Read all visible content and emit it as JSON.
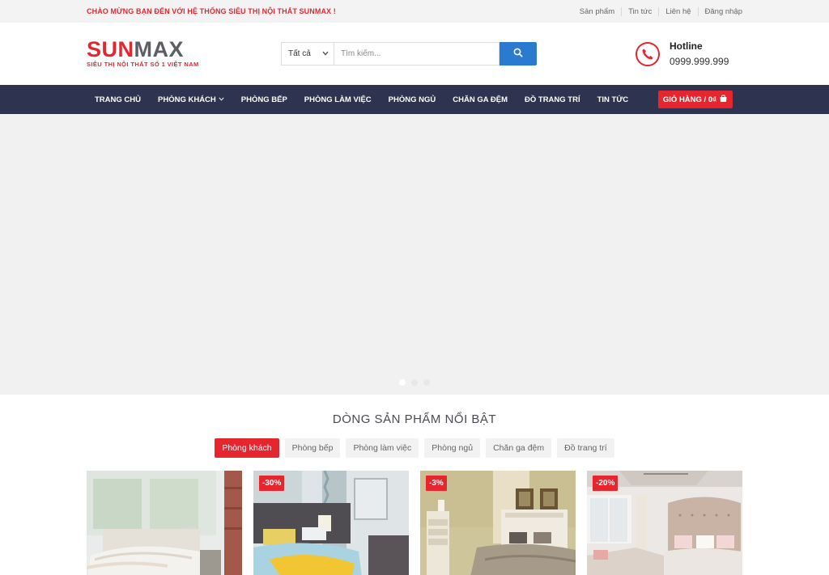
{
  "topbar": {
    "welcome": "CHÀO MỪNG BẠN ĐẾN VỚI HỆ THỐNG SIÊU THỊ NỘI THẤT SUNMAX !",
    "links": [
      "Sản phẩm",
      "Tin tức",
      "Liên hệ",
      "Đăng nhập"
    ]
  },
  "header": {
    "logo_part1": "SUN",
    "logo_part2": "MAX",
    "logo_tagline": "SIÊU THỊ NỘI THẤT SỐ 1 VIỆT NAM",
    "search": {
      "category": "Tất cả",
      "placeholder": "Tìm kiếm..."
    },
    "hotline": {
      "title": "Hotline",
      "number": "0999.999.999"
    }
  },
  "nav": {
    "items": [
      "TRANG CHỦ",
      "PHÒNG KHÁCH",
      "PHÒNG BẾP",
      "PHÒNG LÀM VIỆC",
      "PHÒNG NGỦ",
      "CHĂN GA ĐỆM",
      "ĐỒ TRANG TRÍ",
      "TIN TỨC"
    ],
    "cart_label": "GIỎ HÀNG / 0₫"
  },
  "slider": {
    "slide_count": 3,
    "active_index": 0
  },
  "featured": {
    "title": "DÒNG SẢN PHẨM NỔI BẬT",
    "tabs": [
      "Phòng khách",
      "Phòng bếp",
      "Phòng làm việc",
      "Phòng ngủ",
      "Chăn ga đệm",
      "Đồ trang trí"
    ],
    "active_tab": 0,
    "products": [
      {
        "badge": ""
      },
      {
        "badge": "-30%"
      },
      {
        "badge": "-3%"
      },
      {
        "badge": "-20%"
      }
    ]
  },
  "colors": {
    "brand_red": "#e5262f",
    "nav_bg": "#2e3450",
    "search_btn": "#2a7bd0"
  },
  "icons": {
    "search": "search-icon",
    "phone": "phone-icon",
    "cart": "shopping-bag-icon",
    "dropdown": "chevron-down-icon"
  }
}
